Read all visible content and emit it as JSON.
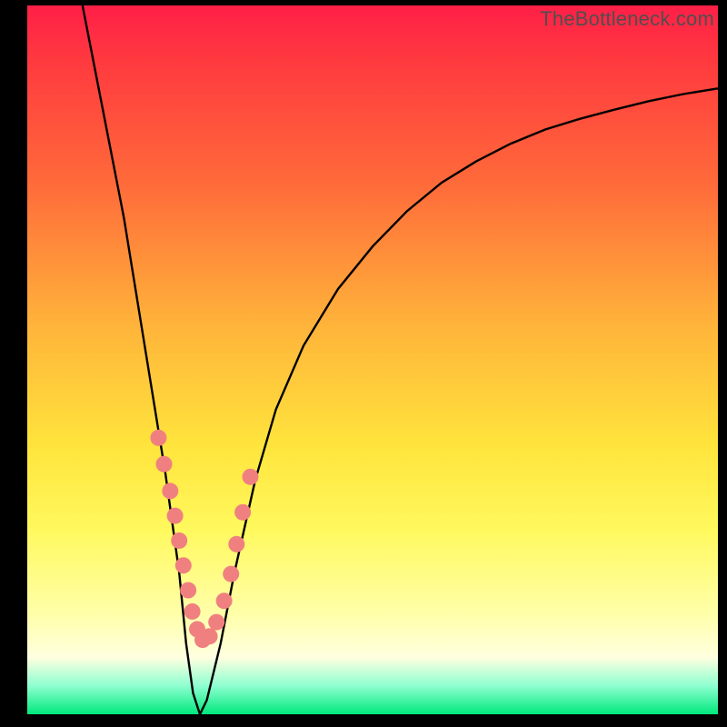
{
  "watermark": "TheBottleneck.com",
  "colors": {
    "curve": "#000000",
    "dots": "#f08080",
    "gradient_top": "#ff1f47",
    "gradient_bottom": "#00e87c"
  },
  "chart_data": {
    "type": "line",
    "title": "",
    "xlabel": "",
    "ylabel": "",
    "xlim": [
      0,
      100
    ],
    "ylim": [
      0,
      100
    ],
    "series": [
      {
        "name": "bottleneck-curve",
        "x": [
          8,
          10,
          12,
          14,
          16,
          18,
          20,
          22,
          23,
          24,
          25,
          26,
          28,
          30,
          33,
          36,
          40,
          45,
          50,
          55,
          60,
          65,
          70,
          75,
          80,
          85,
          90,
          95,
          100
        ],
        "y": [
          100,
          90,
          80,
          70,
          58,
          46,
          34,
          20,
          10,
          3,
          0,
          2,
          10,
          20,
          33,
          43,
          52,
          60,
          66,
          71,
          75,
          78,
          80.5,
          82.5,
          84,
          85.3,
          86.5,
          87.5,
          88.3
        ]
      }
    ],
    "highlight_points": {
      "name": "highlight-dots",
      "x_pct": [
        19.0,
        19.8,
        20.7,
        21.4,
        22.0,
        22.6,
        23.3,
        23.9,
        24.6,
        25.4,
        26.4,
        27.4,
        28.5,
        29.5,
        30.3,
        31.2,
        32.3
      ],
      "y_pct": [
        61.0,
        64.7,
        68.5,
        72.0,
        75.5,
        79.0,
        82.5,
        85.5,
        88.0,
        89.5,
        89.0,
        87.0,
        84.0,
        80.2,
        76.0,
        71.5,
        66.5
      ]
    }
  }
}
